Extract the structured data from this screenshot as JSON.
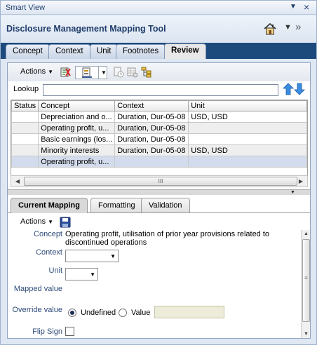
{
  "window": {
    "title": "Smart View",
    "pin_icon": "▼",
    "close_icon": "×"
  },
  "header": {
    "title": "Disclosure Management Mapping Tool",
    "menu_caret": "▼",
    "more_icon": "»"
  },
  "tabs": [
    {
      "label": "Concept",
      "active": false
    },
    {
      "label": "Context",
      "active": false
    },
    {
      "label": "Unit",
      "active": false
    },
    {
      "label": "Footnotes",
      "active": false
    },
    {
      "label": "Review",
      "active": true
    }
  ],
  "toolbar": {
    "actions_label": "Actions",
    "caret": "▼"
  },
  "lookup": {
    "label": "Lookup",
    "value": ""
  },
  "grid": {
    "columns": [
      "Status",
      "Concept",
      "Context",
      "Unit"
    ],
    "rows": [
      {
        "status": "",
        "concept": "Depreciation and o...",
        "context": "Duration, Dur-05-08",
        "unit": "USD, USD"
      },
      {
        "status": "",
        "concept": "Operating profit, u...",
        "context": "Duration, Dur-05-08",
        "unit": ""
      },
      {
        "status": "",
        "concept": "Basic earnings (los...",
        "context": "Duration, Dur-05-08",
        "unit": ""
      },
      {
        "status": "",
        "concept": "Minority interests",
        "context": "Duration, Dur-05-08",
        "unit": "USD, USD"
      },
      {
        "status": "",
        "concept": "Operating profit, u...",
        "context": "",
        "unit": ""
      }
    ],
    "selected_row": 4,
    "scroll_grip": "III"
  },
  "subtabs": [
    {
      "label": "Current Mapping",
      "active": true
    },
    {
      "label": "Formatting",
      "active": false
    },
    {
      "label": "Validation",
      "active": false
    }
  ],
  "mapping": {
    "actions_label": "Actions",
    "concept_label": "Concept",
    "concept_value": "Operating profit, utilisation of prior year provisions related to discontinued operations",
    "context_label": "Context",
    "context_value": "",
    "unit_label": "Unit",
    "unit_value": "",
    "mapped_value_label": "Mapped value",
    "mapped_value": "",
    "override_label": "Override value",
    "override_undefined": "Undefined",
    "override_value": "Value",
    "override_selected": "Undefined",
    "flip_sign_label": "Flip Sign",
    "flip_sign_checked": false,
    "scroll_grip": "≡"
  },
  "colors": {
    "tab_strip": "#1c4a7c",
    "header_text": "#1f3d6b",
    "field_label": "#2e4b7a",
    "selected_row": "#d3dcec"
  }
}
